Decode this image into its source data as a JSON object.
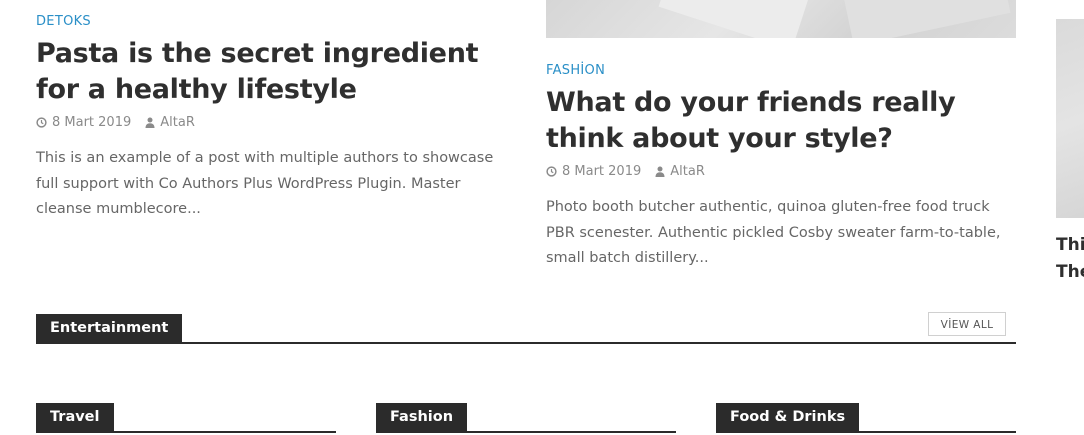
{
  "posts": [
    {
      "category": "DETOKS",
      "title": "Pasta is the secret ingredient for a healthy lifestyle",
      "date": "8 Mart 2019",
      "author": "AltaR",
      "excerpt": "This is an example of a post with multiple authors to showcase full support with Co Authors Plus WordPress Plugin. Master cleanse mumblecore..."
    },
    {
      "category": "FASHİON",
      "title": "What do your friends really think about your style?",
      "date": "8 Mart 2019",
      "author": "AltaR",
      "excerpt": "Photo booth butcher authentic, quinoa gluten-free food truck PBR scenester. Authentic pickled Cosby sweater farm-to-table, small batch distillery..."
    }
  ],
  "side_post": {
    "title_line1": "Thi",
    "title_line2": "The"
  },
  "sections": {
    "entertainment": {
      "label": "Entertainment",
      "view_all": "VİEW ALL"
    },
    "travel": {
      "label": "Travel"
    },
    "fashion": {
      "label": "Fashion"
    },
    "food_drinks": {
      "label": "Food & Drinks"
    }
  },
  "colors": {
    "category_link": "#2a8fc7",
    "title": "#2f2f2f",
    "meta": "#8a8a8a",
    "section_tab_bg": "#2b2b2b"
  },
  "icons": {
    "date": "clock-icon",
    "author": "user-icon"
  }
}
